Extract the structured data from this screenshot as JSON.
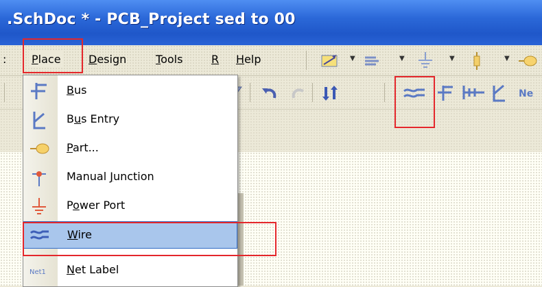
{
  "window": {
    "title": ".SchDoc * - PCB_Project  sed to 00"
  },
  "menubar": {
    "colon": ":",
    "items": [
      {
        "prefix": "",
        "underline": "P",
        "rest": "lace",
        "name": "menu-place"
      },
      {
        "prefix": "",
        "underline": "D",
        "rest": "esign",
        "name": "menu-design"
      },
      {
        "prefix": "",
        "underline": "T",
        "rest": "ools",
        "name": "menu-tools"
      },
      {
        "prefix": "",
        "underline": "R",
        "rest": "",
        "name": "menu-reports"
      },
      {
        "prefix": "",
        "underline": "H",
        "rest": "elp",
        "name": "menu-help"
      }
    ]
  },
  "place_menu": {
    "items": [
      {
        "icon": "bus-icon",
        "pre": "",
        "u": "B",
        "post": "us"
      },
      {
        "icon": "bus-entry-icon",
        "pre": "B",
        "u": "u",
        "post": "s Entry"
      },
      {
        "icon": "part-icon",
        "pre": "",
        "u": "P",
        "post": "art..."
      },
      {
        "icon": "junction-icon",
        "pre": "Manual ",
        "u": "J",
        "post": "unction"
      },
      {
        "icon": "power-port-icon",
        "pre": "P",
        "u": "o",
        "post": "wer Port"
      },
      {
        "icon": "wire-icon",
        "pre": "",
        "u": "W",
        "post": "ire",
        "highlighted": true
      },
      {
        "icon": "net-label-icon",
        "pre": "",
        "u": "N",
        "post": "et Label"
      }
    ]
  },
  "net_label_icon_text": "Net1",
  "colors": {
    "highlight_box": "#e4262b",
    "menu_selection": "#a9c6ec",
    "titlebar": "#2b68d8"
  }
}
